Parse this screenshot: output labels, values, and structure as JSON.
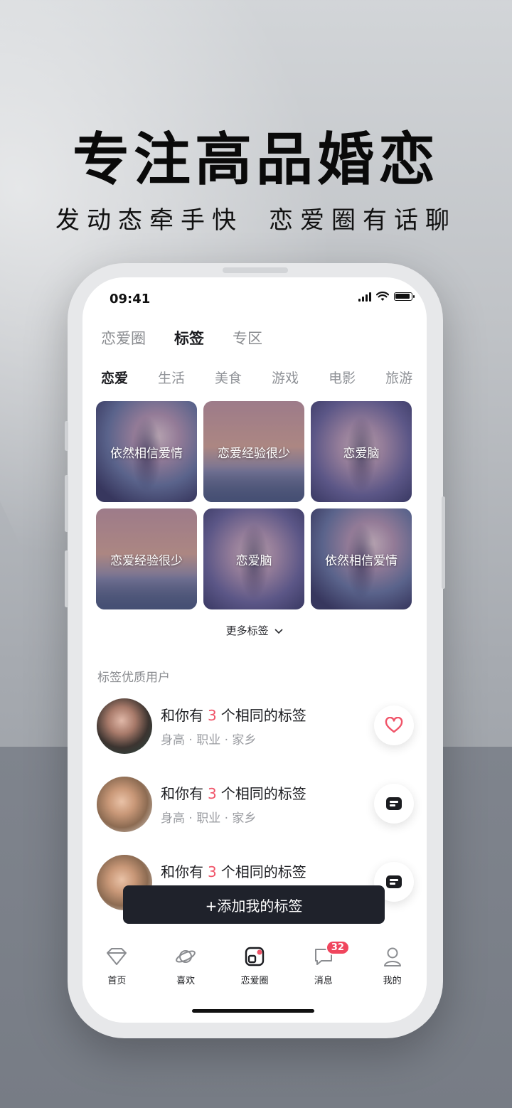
{
  "hero": {
    "title": "专注高品婚恋",
    "subtitle_left": "发动态牵手快",
    "subtitle_right": "恋爱圈有话聊"
  },
  "status_bar": {
    "time": "09:41"
  },
  "top_tabs": [
    {
      "label": "恋爱圈",
      "active": false
    },
    {
      "label": "标签",
      "active": true
    },
    {
      "label": "专区",
      "active": false
    }
  ],
  "category_tabs": [
    {
      "label": "恋爱",
      "active": true
    },
    {
      "label": "生活",
      "active": false
    },
    {
      "label": "美食",
      "active": false
    },
    {
      "label": "游戏",
      "active": false
    },
    {
      "label": "电影",
      "active": false
    },
    {
      "label": "旅游",
      "active": false
    }
  ],
  "tag_tiles": [
    {
      "label": "依然相信爱情"
    },
    {
      "label": "恋爱经验很少"
    },
    {
      "label": "恋爱脑"
    },
    {
      "label": "恋爱经验很少"
    },
    {
      "label": "恋爱脑"
    },
    {
      "label": "依然相信爱情"
    }
  ],
  "more_tags_label": "更多标签",
  "section_title": "标签优质用户",
  "users": [
    {
      "prefix": "和你有",
      "count": "3",
      "suffix": "个相同的标签",
      "meta": "身高 · 职业 · 家乡",
      "action_icon": "heart-icon"
    },
    {
      "prefix": "和你有",
      "count": "3",
      "suffix": "个相同的标签",
      "meta": "身高 · 职业 · 家乡",
      "action_icon": "chat-icon"
    },
    {
      "prefix": "和你有",
      "count": "3",
      "suffix": "个相同的标签",
      "meta": "",
      "action_icon": "chat-icon"
    }
  ],
  "add_button_label": "+添加我的标签",
  "tabbar": [
    {
      "label": "首页",
      "icon": "diamond-icon"
    },
    {
      "label": "喜欢",
      "icon": "planet-icon"
    },
    {
      "label": "恋爱圈",
      "icon": "circle-square-icon"
    },
    {
      "label": "消息",
      "icon": "message-icon",
      "badge": "32"
    },
    {
      "label": "我的",
      "icon": "person-icon"
    }
  ],
  "colors": {
    "accent": "#f05469",
    "badge": "#f0455d",
    "dark_button": "#1f222b"
  }
}
